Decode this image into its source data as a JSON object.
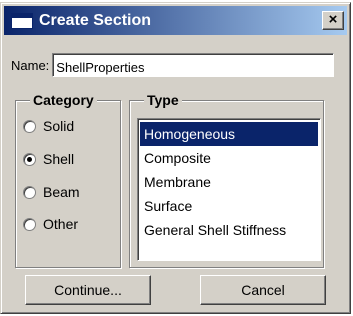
{
  "window": {
    "title": "Create Section",
    "close_label": "×"
  },
  "name_field": {
    "label": "Name:",
    "value": "ShellProperties"
  },
  "category": {
    "legend": "Category",
    "options": [
      {
        "label": "Solid",
        "selected": false
      },
      {
        "label": "Shell",
        "selected": true
      },
      {
        "label": "Beam",
        "selected": false
      },
      {
        "label": "Other",
        "selected": false
      }
    ]
  },
  "type": {
    "legend": "Type",
    "items": [
      {
        "label": "Homogeneous",
        "selected": true
      },
      {
        "label": "Composite",
        "selected": false
      },
      {
        "label": "Membrane",
        "selected": false
      },
      {
        "label": "Surface",
        "selected": false
      },
      {
        "label": "General Shell Stiffness",
        "selected": false
      }
    ]
  },
  "buttons": {
    "continue_label": "Continue...",
    "cancel_label": "Cancel"
  },
  "colors": {
    "dialog_face": "#d4d0c8",
    "title_start": "#0a246a",
    "title_end": "#a6caf0",
    "selection": "#0a246a"
  }
}
